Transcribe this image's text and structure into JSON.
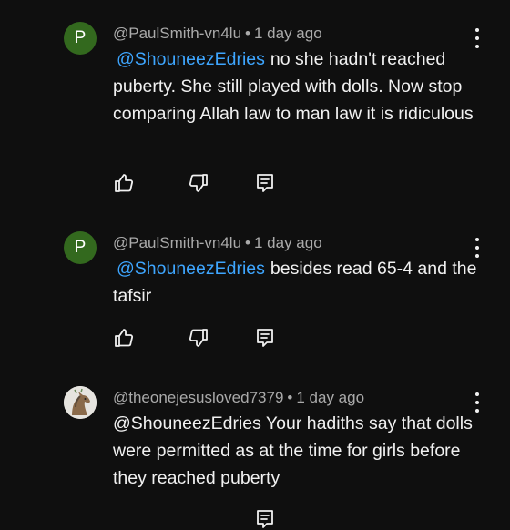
{
  "comments": [
    {
      "avatar_letter": "P",
      "author": "@PaulSmith-vn4lu",
      "separator": "•",
      "time": "1 day ago",
      "mention": "@ShouneezEdries",
      "text": "no she hadn't reached puberty.  She still played with dolls.  Now stop comparing Allah law to man law it is ridiculous"
    },
    {
      "avatar_letter": "P",
      "author": "@PaulSmith-vn4lu",
      "separator": "•",
      "time": "1 day ago",
      "mention": "@ShouneezEdries",
      "text": "besides read 65-4 and the tafsir"
    },
    {
      "avatar_icon": "horse-avatar-icon",
      "author": "@theonejesusloved7379",
      "separator": "•",
      "time": "1 day ago",
      "mention": "@ShouneezEdries",
      "text": "Your hadiths say that dolls were permitted as at the time for girls before they reached puberty"
    }
  ],
  "icons": {
    "like": "thumbs-up-icon",
    "dislike": "thumbs-down-icon",
    "reply": "reply-comment-icon",
    "more": "more-vertical-icon"
  },
  "colors": {
    "background": "#0f0f0f",
    "text": "#f1f1f1",
    "meta": "#aaaaaa",
    "mention": "#3ea6ff",
    "avatar_p": "#33691e"
  }
}
